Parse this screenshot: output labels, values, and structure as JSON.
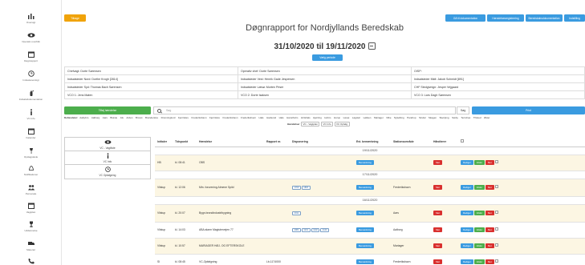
{
  "sidebar": [
    {
      "label": "Oversigt",
      "icon": "chart-icon"
    },
    {
      "label": "Operativ overblik",
      "icon": "eye-icon"
    },
    {
      "label": "Døgnrapport",
      "icon": "calendar-icon"
    },
    {
      "label": "Indsatsoversigt",
      "icon": "clock-icon"
    },
    {
      "label": "Indsatsdokumentation",
      "icon": "extinguisher-icon"
    },
    {
      "label": "VC Info",
      "icon": "info-icon"
    },
    {
      "label": "Kalender",
      "icon": "calendar-icon"
    },
    {
      "label": "Opslagstavle",
      "icon": "pin-icon"
    },
    {
      "label": "Notifikationer",
      "icon": "bell-icon"
    },
    {
      "label": "Personale",
      "icon": "users-icon"
    },
    {
      "label": "Vagtplan",
      "icon": "calendar-icon"
    },
    {
      "label": "Uddannelse",
      "icon": "trophy-icon"
    },
    {
      "label": "Materiel",
      "icon": "truck-icon"
    },
    {
      "label": "Kontakt",
      "icon": "phone-icon"
    }
  ],
  "top": {
    "back": "Tilbage",
    "buttons": [
      "Gå til dokumentation",
      "Hændelsesregistrering",
      "Beredskabsdokumentation",
      "Indstilling"
    ]
  },
  "title": "Døgnrapport for Nordjyllands Beredskab",
  "daterange": "31/10/2020 til 19/11/2020",
  "select_period": "Vælg periode",
  "staff": [
    [
      "Chefvagt: Dorte Sørensen",
      "Operativ chef: Dorte Sørensen",
      "OISP:"
    ],
    [
      "Indsatsleder Nord: Dorthe Krogh [2814]",
      "Indsatsleder Vest: Henrik Gade Jespersen",
      "Indsatsleder Midt: Jakob Schmidt [891]"
    ],
    [
      "Indsatsleder Syd: Thomas Bach Sørensen",
      "Indsatsleder Læsø: Morten Priser",
      "CHF Stedgivnign: Jesper Vejgaard"
    ],
    [
      "VCO 1: Jens Mølen",
      "VCO 2: Dorte Isaksen",
      "VCO 3: Lars Dagh Sørensen"
    ]
  ],
  "add_event": "Tilføj hændelse",
  "search_placeholder": "Søg",
  "search_button": "Søg",
  "print_button": "Print",
  "departments_label": "Deltavdeler:",
  "departments": [
    "Aabybro",
    "Aalborg",
    "Aars",
    "Brøste",
    "Als",
    "Arden",
    "Brovst",
    "Brønderslev",
    "Dronninglund",
    "Fjerritslev",
    "Frederikshavn",
    "Fjerritslev",
    "Frederikshavn",
    "Frederikshavn",
    "Hals",
    "Hadsund",
    "Hals",
    "Hanstholm",
    "Hirtshals",
    "Hjørring",
    "Hobro",
    "Hurup",
    "Læsø",
    "Løgstør",
    "Løkken",
    "Mariager",
    "Nibe",
    "Nykøbing",
    "Pandrup",
    "Sindal",
    "Skagen",
    "Skørping",
    "Sæby",
    "Terndrup",
    "Thisted",
    "Øster"
  ],
  "hours_label": "Hændelser",
  "hours_chips": [
    "VC - Vagtplan",
    "VC Info",
    "VC Opfølg"
  ],
  "panel": [
    {
      "icon": "eye-icon",
      "label": "VC - Vagtliste"
    },
    {
      "icon": "info-icon",
      "label": "VC Info"
    },
    {
      "icon": "clock-icon",
      "label": "VC Opfølgning"
    }
  ],
  "columns": [
    "Initialer",
    "Tidspunkt",
    "Hændelse",
    "Rapport nr.",
    "Disponering",
    "Evt. bemærkning",
    "Stationsområde",
    "Håndterer",
    ""
  ],
  "rows": [
    {
      "type": "date",
      "text": "19/11/2020"
    },
    {
      "type": "row",
      "style": "yl",
      "init": "HB",
      "time": "kl. 08:41",
      "event": "OBS",
      "report": "",
      "chips": [],
      "station": "",
      "note": "Bemærkning",
      "actions": [
        "red"
      ]
    },
    {
      "type": "date",
      "text": "17/11/2020"
    },
    {
      "type": "row",
      "style": "yl",
      "init": "Vilstup",
      "time": "kl. 12:06",
      "event": "Mtn. forurening Almene Spild",
      "report": "",
      "chips": [
        "1700",
        "1820"
      ],
      "station": "Frederikshavn",
      "note": "Bemærkning",
      "actions": [
        "red"
      ]
    },
    {
      "type": "date",
      "text": "16/11/2020"
    },
    {
      "type": "row",
      "style": "yl",
      "init": "Vilstup",
      "time": "kl. 20:07",
      "event": "Bygn.brandindustribygning",
      "report": "",
      "chips": [
        "2011"
      ],
      "station": "Aars",
      "note": "Bemærkning",
      "actions": [
        "red"
      ]
    },
    {
      "type": "row",
      "style": "wh",
      "init": "Vilstup",
      "time": "kl. 14:03",
      "event": "ABA alarm Magistervejen 77",
      "report": "",
      "chips": [
        "4081",
        "4101",
        "4102",
        "4103"
      ],
      "station": "Aalborg",
      "note": "Bemærkning",
      "actions": [
        "red"
      ]
    },
    {
      "type": "row",
      "style": "yl",
      "init": "Vilstup",
      "time": "kl. 10:57",
      "event": "MARIAGER HØJ- OG EFTERSKOLE",
      "report": "",
      "chips": [],
      "station": "Mariager",
      "note": "Bemærkning",
      "actions": [
        "red"
      ]
    },
    {
      "type": "row",
      "style": "wh",
      "init": "SI",
      "time": "kl. 08:45",
      "event": "VC-Opfølgning",
      "report": "Lb-1174000",
      "chips": [],
      "station": "Frederikshavn",
      "note": "Bemærkning",
      "actions": [
        "red"
      ]
    }
  ],
  "action_labels": {
    "blue": "Rediger",
    "green": "Afslut",
    "red": "Slet",
    "green2": "Rediger"
  }
}
